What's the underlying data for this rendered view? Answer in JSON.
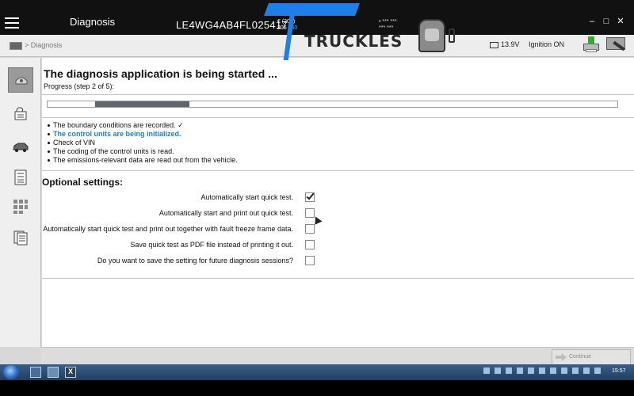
{
  "titlebar": {
    "title": "Diagnosis",
    "vin": "LE4WG4AB4FL025417",
    "info_line1": "€ (205)",
    "info_line2_a": "205",
    "info_line2_b": "140",
    "right_info_line1": "• *** ***",
    "right_info_line2": "*** ***",
    "controls": [
      "–",
      "□",
      "✕"
    ]
  },
  "navbar": {
    "breadcrumb": "> Diagnosis",
    "logo_text": "TRUCKLES",
    "voltage": "13.9V",
    "ignition": "Ignition ON"
  },
  "sidebar": {
    "items": [
      {
        "icon": "start-icon",
        "active": true
      },
      {
        "icon": "vehicle-data-icon",
        "active": false
      },
      {
        "icon": "vehicle-icon",
        "active": false
      },
      {
        "icon": "list-icon",
        "active": false
      },
      {
        "icon": "grid-icon",
        "active": false
      },
      {
        "icon": "documents-icon",
        "active": false
      }
    ]
  },
  "main": {
    "heading": "The diagnosis application is being started ...",
    "progress_label": "Progress (step 2 of 5):",
    "progress": {
      "step": 2,
      "of": 5
    },
    "steps": [
      {
        "text": "The boundary conditions are recorded. ✓",
        "current": false
      },
      {
        "text": "The control units are being initialized.",
        "current": true
      },
      {
        "text": "Check of VIN",
        "current": false
      },
      {
        "text": "The coding of the control units is read.",
        "current": false
      },
      {
        "text": "The emissions-relevant data are read out from the vehicle.",
        "current": false
      }
    ],
    "optional_heading": "Optional settings:",
    "options": [
      {
        "label": "Automatically start quick test.",
        "checked": true
      },
      {
        "label": "Automatically start and print out quick test.",
        "checked": false
      },
      {
        "label": "Automatically start quick test and print out together with fault freeze frame data.",
        "checked": false
      },
      {
        "label": "Save quick test as PDF file instead of printing it out.",
        "checked": false
      },
      {
        "label": "Do you want to save the setting for future diagnosis sessions?",
        "checked": false
      }
    ]
  },
  "footer": {
    "continue_label": "Continue"
  },
  "taskbar": {
    "clock": "15:57"
  },
  "colors": {
    "current_step": "#1a82c8",
    "logo_accent": "#1f7fe8",
    "progress_fill": "#5f6670"
  }
}
